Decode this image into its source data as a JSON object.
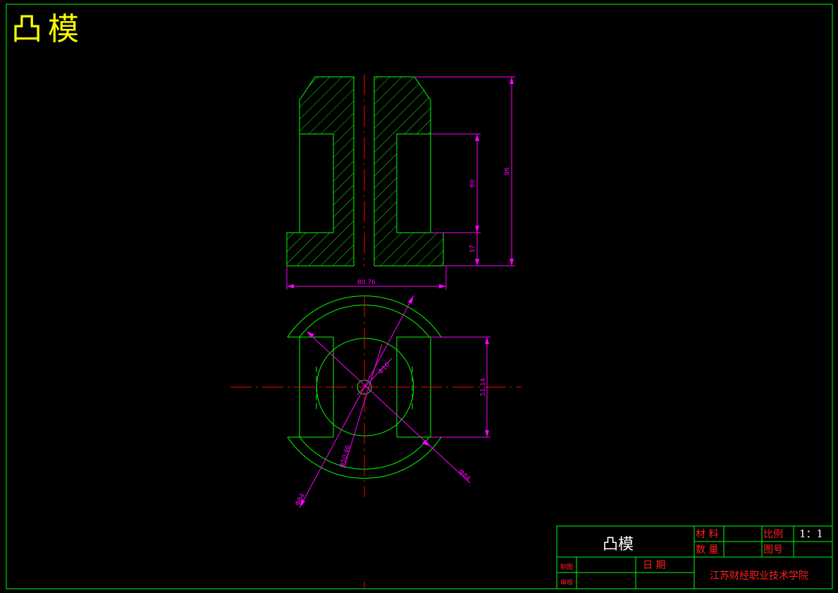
{
  "drawing": {
    "title": "凸模",
    "colors": {
      "background": "#000000",
      "outline": "#00ff00",
      "dimension": "#ff00ff",
      "centerline": "#ff0000",
      "title_text": "#ffff00",
      "label_text": "#ff2020"
    }
  },
  "dimensions": {
    "total_height": "96",
    "pocket_height": "60",
    "base_height": "17",
    "base_width": "80.76",
    "slot_width": "51.14",
    "hole_dia": "Φ10",
    "inner_dia": "Φ50.46",
    "outer_dia_a": "Φ84",
    "outer_dia_b": "Φ84"
  },
  "title_block": {
    "part_name": "凸模",
    "material_label": "材 料",
    "scale_label": "比例",
    "scale_value": "1：1",
    "quantity_label": "数 量",
    "drawing_no_label": "图号",
    "drawn_by_label": "制图",
    "date_label": "日  期",
    "checked_by_label": "审核",
    "institution": "江苏财经职业技术学院"
  }
}
